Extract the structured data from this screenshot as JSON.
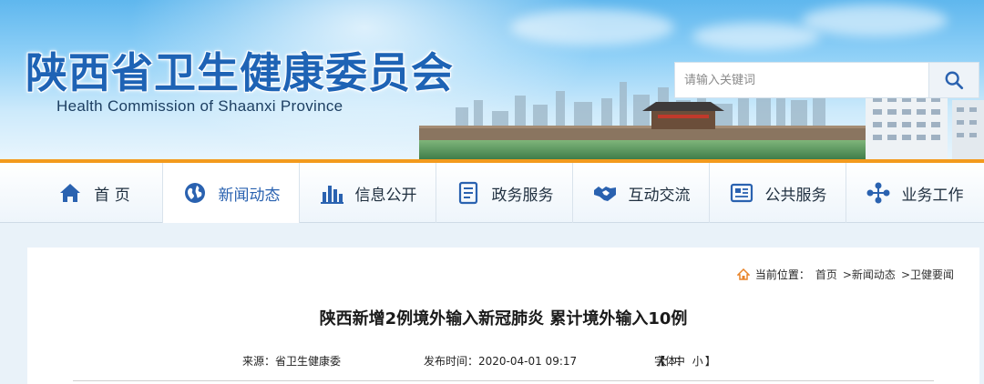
{
  "header": {
    "title_cn": "陕西省卫生健康委员会",
    "title_en": "Health Commission of Shaanxi Province",
    "search": {
      "placeholder": "请输入关键词",
      "button_icon": "search-icon"
    },
    "accent_color": "#1e63b5",
    "stripe_color": "#f39a1d"
  },
  "nav": {
    "items": [
      {
        "label": "首 页",
        "icon": "home-icon",
        "active": false
      },
      {
        "label": "新闻动态",
        "icon": "globe-icon",
        "active": true
      },
      {
        "label": "信息公开",
        "icon": "bar-chart-icon",
        "active": false
      },
      {
        "label": "政务服务",
        "icon": "document-icon",
        "active": false
      },
      {
        "label": "互动交流",
        "icon": "handshake-icon",
        "active": false
      },
      {
        "label": "公共服务",
        "icon": "news-card-icon",
        "active": false
      },
      {
        "label": "业务工作",
        "icon": "network-icon",
        "active": false
      }
    ]
  },
  "article": {
    "breadcrumb": {
      "prefix": "当前位置：",
      "items": [
        "首页",
        ">新闻动态",
        ">卫健要闻"
      ]
    },
    "title": "陕西新增2例境外输入新冠肺炎 累计境外输入10例",
    "source": "来源：省卫生健康委",
    "published": "发布时间：2020-04-01 09:17",
    "font_label": "字体：",
    "font_sizes": {
      "open": "【",
      "large": "大",
      "medium": "中",
      "small": "小",
      "close": "】"
    }
  }
}
